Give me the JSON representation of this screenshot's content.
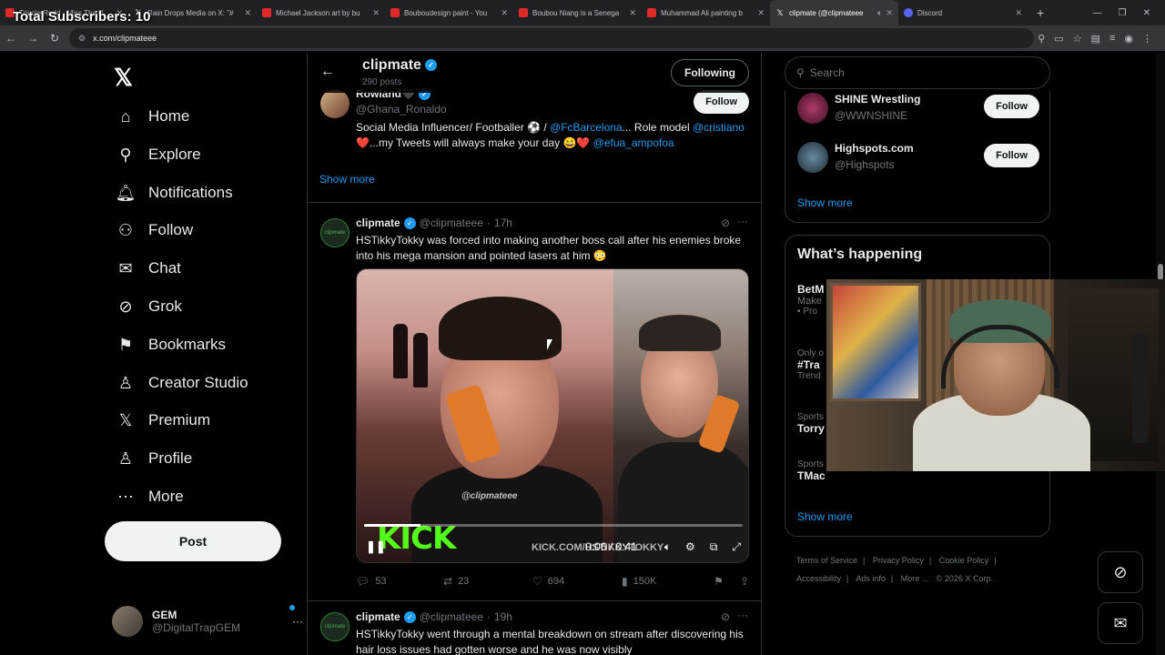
{
  "overlay": {
    "subscribers": "Total Subscribers: 10"
  },
  "browser": {
    "tabs": [
      {
        "title": "Trippie Redd - Miss The R",
        "icon": "youtube-icon"
      },
      {
        "title": "Rain Drops Media on X: \"#",
        "icon": "x-icon"
      },
      {
        "title": "Michael Jackson art by bu",
        "icon": "youtube-icon"
      },
      {
        "title": "Bouboudesign paint - You",
        "icon": "youtube-icon"
      },
      {
        "title": "Boubou Niang is a Senega",
        "icon": "youtube-icon"
      },
      {
        "title": "Muhammad Ali painting b",
        "icon": "youtube-icon"
      },
      {
        "title": "clipmate (@clipmateee",
        "icon": "x-icon",
        "active": true
      },
      {
        "title": "Discord",
        "icon": "discord-icon"
      }
    ],
    "url": "x.com/clipmateee"
  },
  "nav": {
    "items": [
      {
        "label": "Home",
        "icon": "⌂"
      },
      {
        "label": "Explore",
        "icon": "⚲"
      },
      {
        "label": "Notifications",
        "icon": "🔔︎"
      },
      {
        "label": "Follow",
        "icon": "⚇"
      },
      {
        "label": "Chat",
        "icon": "✉"
      },
      {
        "label": "Grok",
        "icon": "⊘"
      },
      {
        "label": "Bookmarks",
        "icon": "⚑"
      },
      {
        "label": "Creator Studio",
        "icon": "♙"
      },
      {
        "label": "Premium",
        "icon": "𝕏"
      },
      {
        "label": "Profile",
        "icon": "♙"
      },
      {
        "label": "More",
        "icon": "⋯"
      }
    ],
    "post_label": "Post",
    "account": {
      "name": "GEM",
      "handle": "@DigitalTrapGEM"
    }
  },
  "header": {
    "name": "clipmate",
    "post_count": "290 posts",
    "following_label": "Following"
  },
  "suggestion": {
    "name": "Rowland🖤",
    "handle": "@Ghana_Ronaldo",
    "follow_label": "Follow",
    "bio_1": "Social Media Influencer/ Footballer ⚽ / ",
    "bio_link_1": "@FcBarcelona",
    "bio_2": "... Role model",
    "bio_link_2": "@cristiano",
    "bio_3": " ❤️...my Tweets will always make your day 😀❤️ ",
    "bio_link_3": "@efua_ampofoa",
    "show_more": "Show more"
  },
  "tweets": [
    {
      "name": "clipmate",
      "handle": "@clipmateee",
      "time": "17h",
      "text": "HSTikkyTokky was forced into making another boss call after his enemies broke into his mega mansion and pointed lasers at him 😳",
      "video": {
        "watermark": "@clipmateee",
        "brand": "KICK",
        "brand_url": "KICK.COM/HSTIKKYTOKKY",
        "current_time": "0:06",
        "duration": "0:41",
        "progress": 0.15
      },
      "replies": "53",
      "reposts": "23",
      "likes": "694",
      "views": "150K"
    },
    {
      "name": "clipmate",
      "handle": "@clipmateee",
      "time": "19h",
      "text": "HSTikkyTokky went through a mental breakdown on stream after discovering his hair loss issues had gotten worse and he was now visibly"
    }
  ],
  "right": {
    "search_placeholder": "Search",
    "who_to_follow": [
      {
        "name": "SHINE Wrestling",
        "handle": "@WWNSHINE",
        "follow_label": "Follow"
      },
      {
        "name": "Highspots.com",
        "handle": "@Highspots",
        "follow_label": "Follow"
      }
    ],
    "show_more": "Show more",
    "happening_title": "What’s happening",
    "trends": [
      {
        "title": "BetM",
        "sub": "Make",
        "ctx": "Pro"
      },
      {
        "ctx": "Only o",
        "title": "#Tra",
        "sub": "Trend"
      },
      {
        "ctx": "Sports",
        "title": "Torry"
      },
      {
        "ctx": "Sports",
        "title": "TMac"
      }
    ],
    "happening_show_more": "Show more",
    "footer": [
      "Terms of Service",
      "|",
      "Privacy Policy",
      "|",
      "Cookie Policy",
      "|",
      "Accessibility",
      "|",
      "Ads info",
      "|",
      "More ...",
      "© 2026 X Corp."
    ]
  }
}
